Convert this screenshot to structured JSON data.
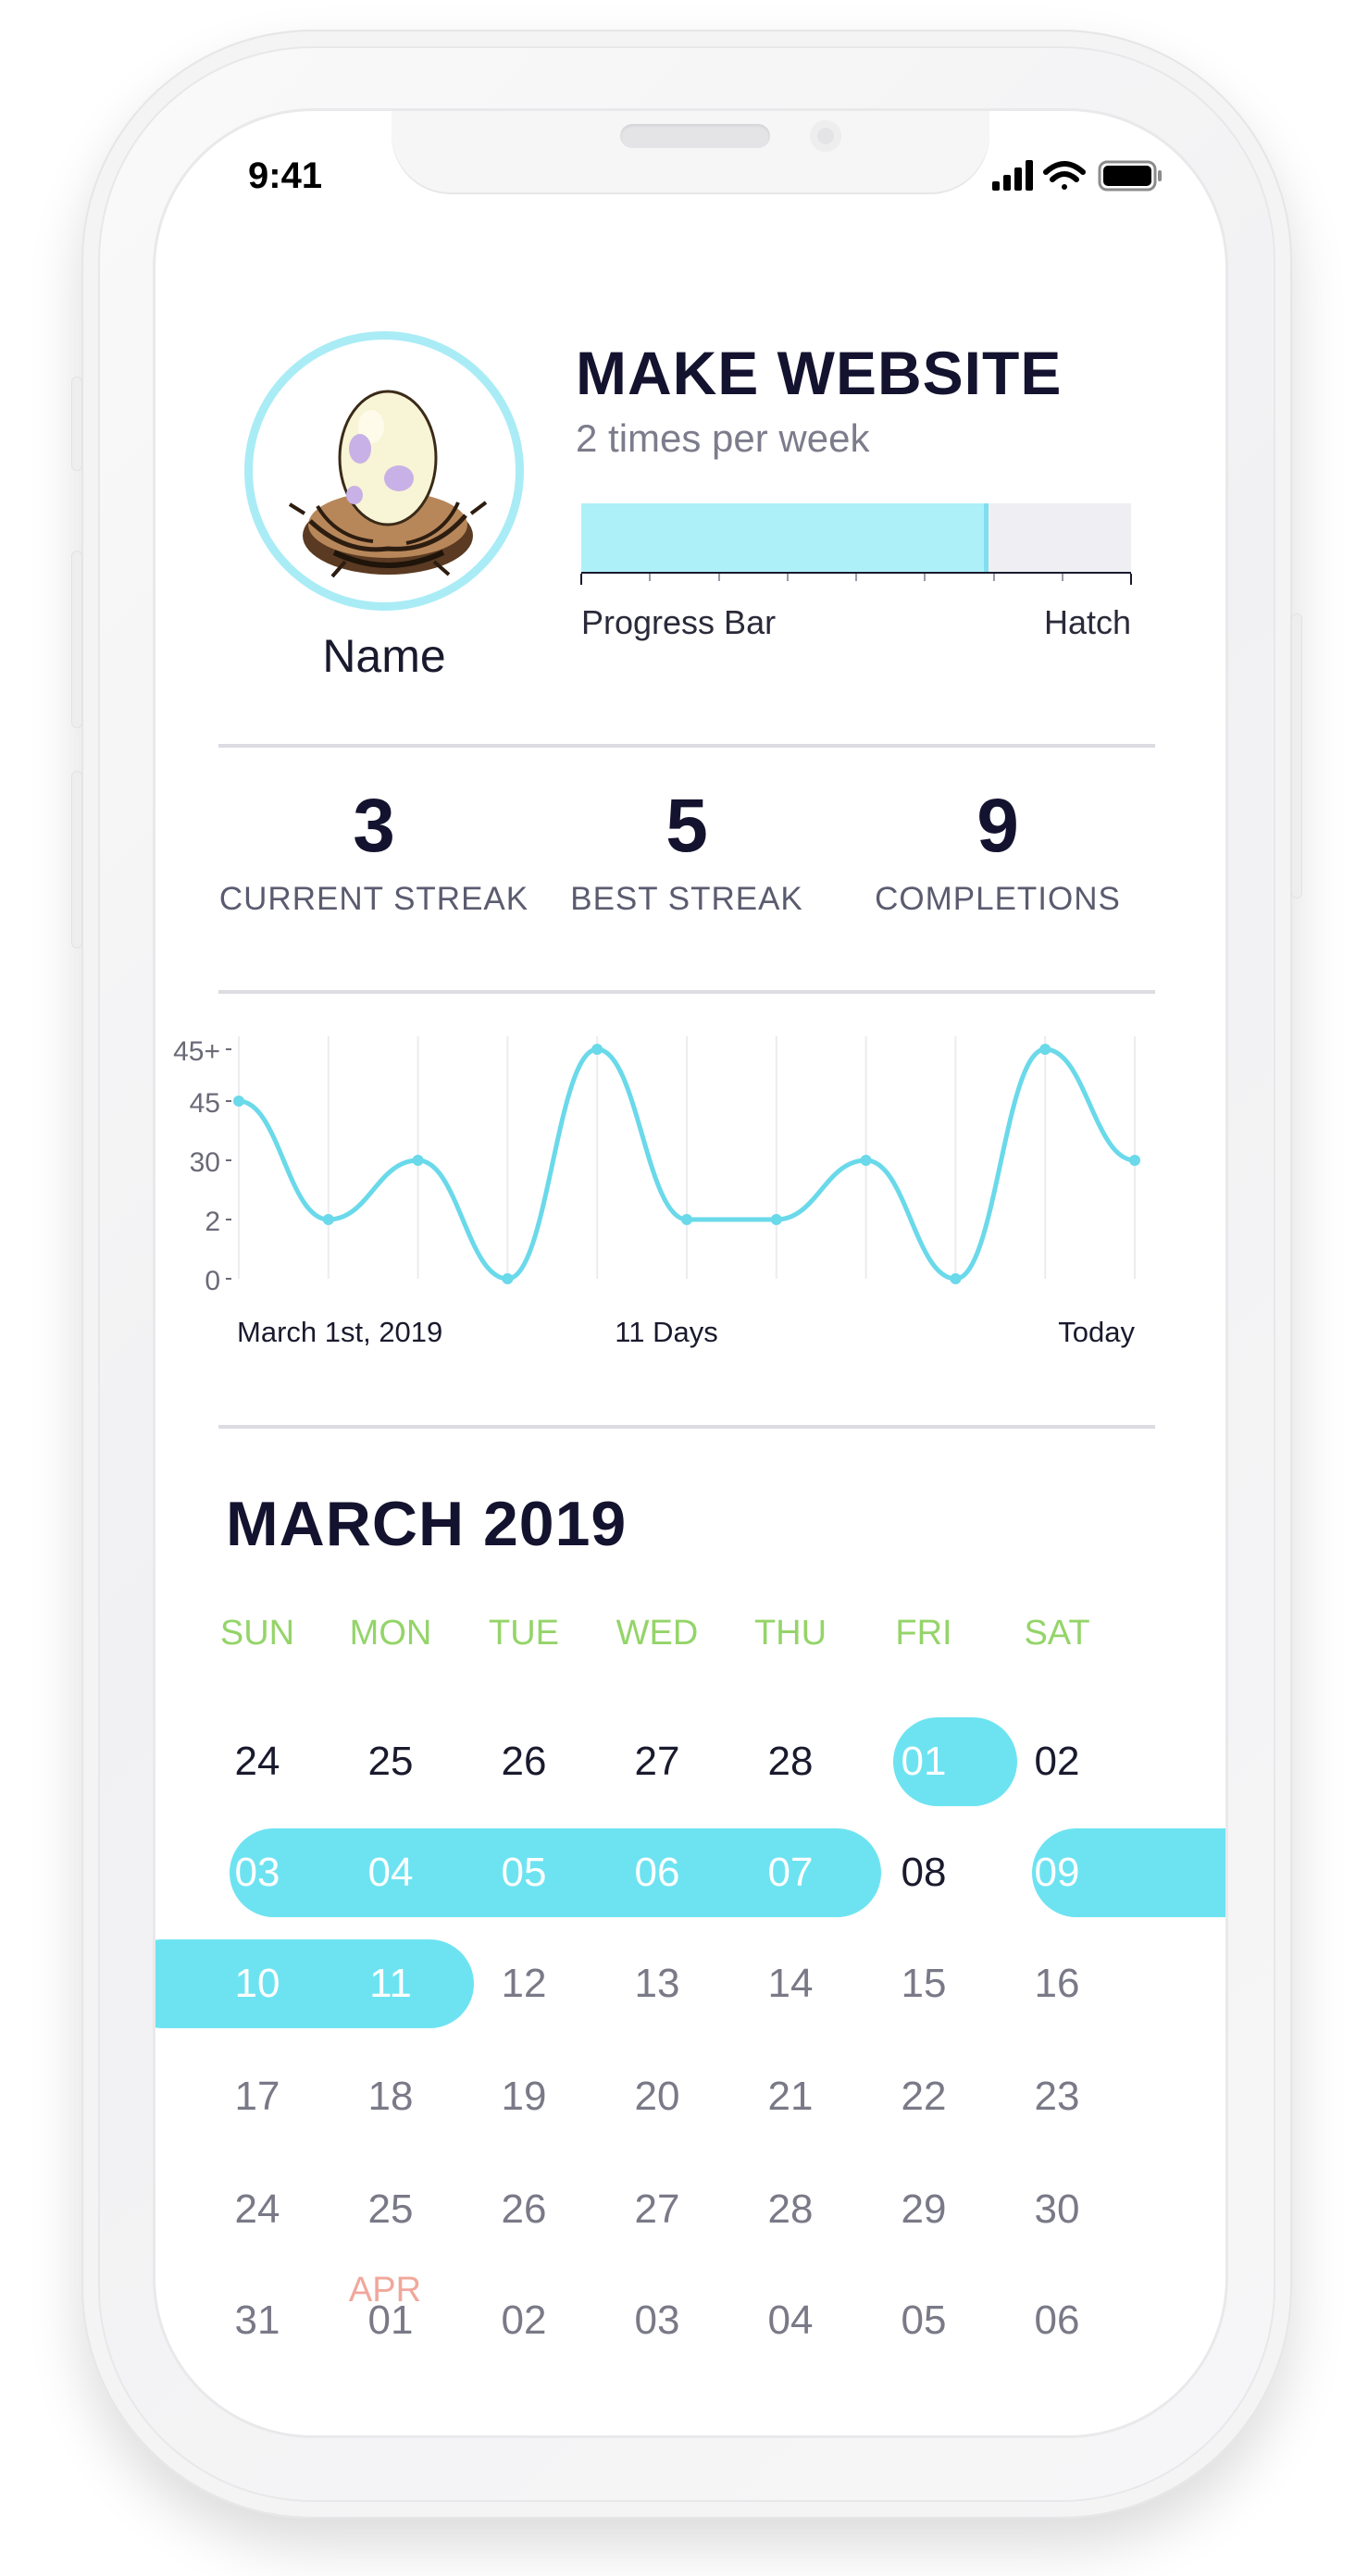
{
  "status_bar": {
    "time": "9:41"
  },
  "habit": {
    "name": "Name",
    "title": "MAKE WEBSITE",
    "frequency": "2 times per week",
    "progress_fraction": 0.74,
    "progress_label": "Progress Bar",
    "progress_end_label": "Hatch",
    "icon": "egg-in-nest-icon"
  },
  "stats": [
    {
      "value": "3",
      "label": "CURRENT STREAK"
    },
    {
      "value": "5",
      "label": "BEST STREAK"
    },
    {
      "value": "9",
      "label": "COMPLETIONS"
    }
  ],
  "chart_data": {
    "type": "line",
    "y_tick_labels": [
      "45+",
      "45",
      "30",
      "2",
      "0"
    ],
    "values": [
      3,
      1,
      2,
      0,
      4,
      1,
      1,
      2,
      0,
      4,
      2
    ],
    "x_labels": {
      "start": "March 1st, 2019",
      "middle": "11 Days",
      "end": "Today"
    },
    "color": "#6ad9ea",
    "grid": "vertical"
  },
  "calendar": {
    "title": "MARCH 2019",
    "weekdays": [
      "SUN",
      "MON",
      "TUE",
      "WED",
      "THU",
      "FRI",
      "SAT"
    ],
    "weeks": [
      [
        "24",
        "25",
        "26",
        "27",
        "28",
        "01",
        "02"
      ],
      [
        "03",
        "04",
        "05",
        "06",
        "07",
        "08",
        "09"
      ],
      [
        "10",
        "11",
        "12",
        "13",
        "14",
        "15",
        "16"
      ],
      [
        "17",
        "18",
        "19",
        "20",
        "21",
        "22",
        "23"
      ],
      [
        "24",
        "25",
        "26",
        "27",
        "28",
        "29",
        "30"
      ],
      [
        "31",
        "01",
        "02",
        "03",
        "04",
        "05",
        "06"
      ]
    ],
    "next_month_label": "APR",
    "completed_days": [
      "01",
      "03",
      "04",
      "05",
      "06",
      "07",
      "09",
      "10",
      "11"
    ],
    "highlight_color": "#6de3f1",
    "weekday_color": "#94d469"
  }
}
